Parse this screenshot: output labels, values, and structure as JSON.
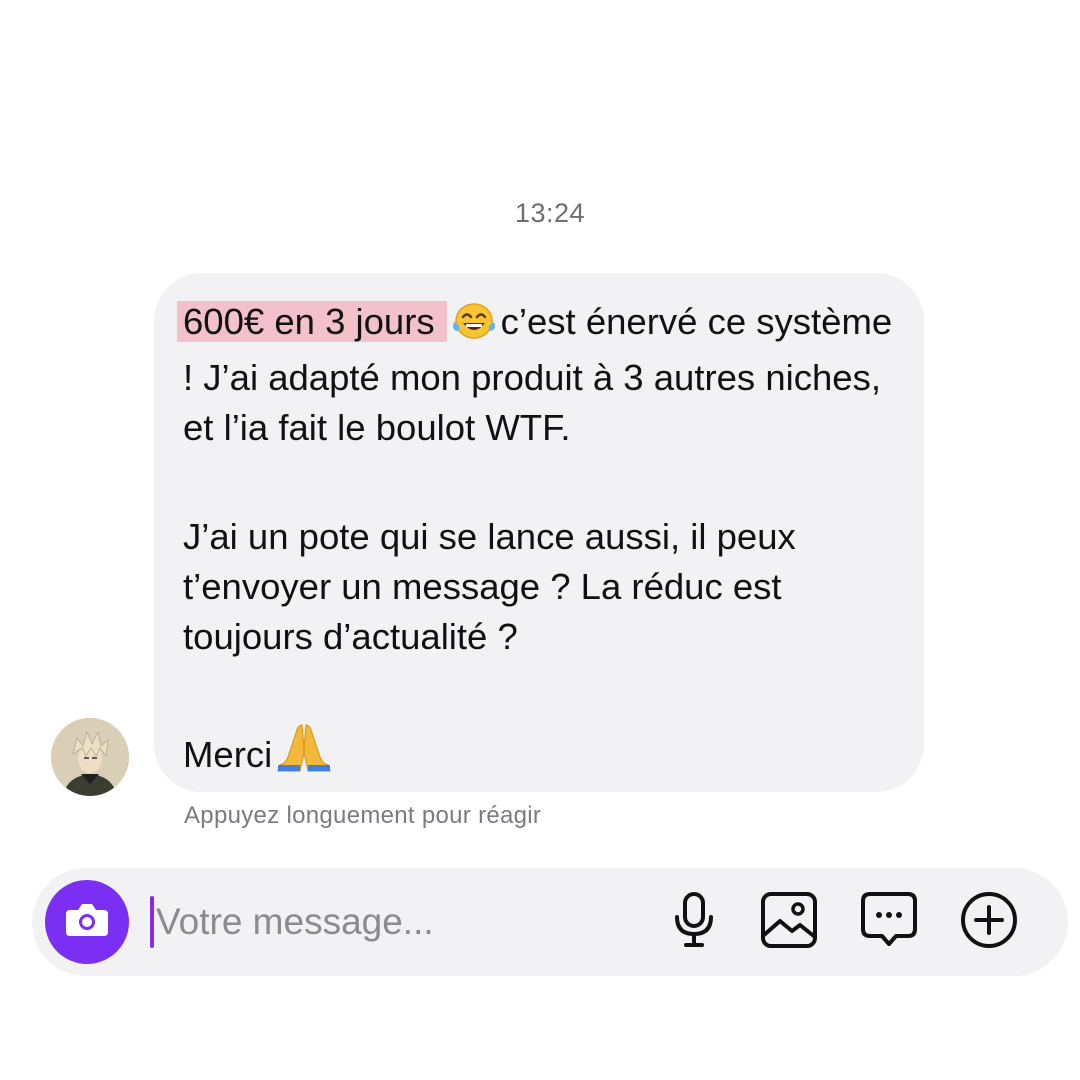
{
  "conversation": {
    "timestamp": "13:24",
    "message": {
      "highlight": "600€ en 3 jours",
      "line1_rest": "c’est énervé ce système ! J’ai adapté mon produit à 3 autres niches, et l’ia fait le boulot WTF.",
      "paragraph2": "J’ai un pote qui se lance aussi, il peux t’envoyer un message ? La réduc est toujours d’actualité ?",
      "paragraph3": "Merci"
    },
    "hint": "Appuyez longuement pour réagir"
  },
  "composer": {
    "placeholder": "Votre message..."
  },
  "icons": {
    "camera": "camera-icon",
    "microphone": "microphone-icon",
    "gallery": "image-icon",
    "sticker": "chat-bubble-icon",
    "more": "plus-circle-icon",
    "emoji_laugh": "tears-of-joy-emoji",
    "emoji_pray": "folded-hands-emoji"
  },
  "colors": {
    "accent": "#7b2ff2",
    "bubble": "#f2f2f5",
    "highlight": "#f3c1c9"
  }
}
